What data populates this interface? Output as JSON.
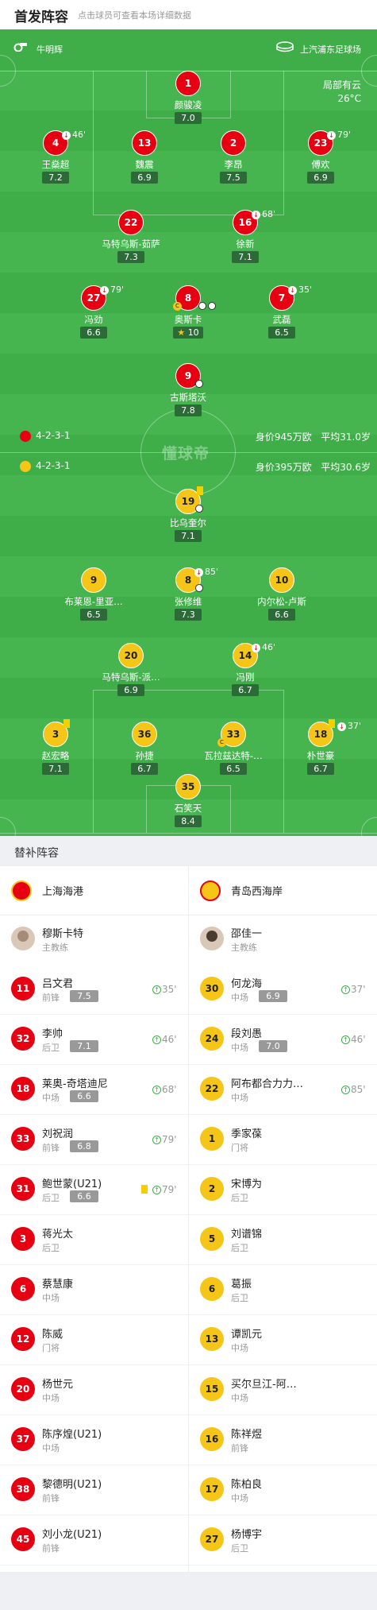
{
  "header": {
    "title": "首发阵容",
    "subtitle": "点击球员可查看本场详细数据"
  },
  "pitch": {
    "home_coach": "牛明辉",
    "venue": "上汽浦东足球场",
    "weather": "局部有云",
    "temperature": "26°C",
    "brand": "懂球帝",
    "top_team": {
      "formation": "4-2-3-1",
      "value": "身价945万欧",
      "avg_age": "平均31.0岁"
    },
    "bottom_team": {
      "formation": "4-2-3-1",
      "value": "身价395万欧",
      "avg_age": "平均30.6岁"
    },
    "top_players": [
      {
        "num": "1",
        "name": "颜骏凌",
        "rating": "7.0"
      },
      {
        "num": "4",
        "name": "王燊超",
        "rating": "7.2",
        "sub": "46'"
      },
      {
        "num": "13",
        "name": "魏震",
        "rating": "6.9"
      },
      {
        "num": "2",
        "name": "李昂",
        "rating": "7.5"
      },
      {
        "num": "23",
        "name": "傅欢",
        "rating": "6.9",
        "sub": "79'"
      },
      {
        "num": "22",
        "name": "马特乌斯-茹萨",
        "rating": "7.3"
      },
      {
        "num": "16",
        "name": "徐新",
        "rating": "7.1",
        "sub": "68'"
      },
      {
        "num": "27",
        "name": "冯劲",
        "rating": "6.6",
        "sub": "79'"
      },
      {
        "num": "8",
        "name": "奥斯卡",
        "rating": "10"
      },
      {
        "num": "7",
        "name": "武磊",
        "rating": "6.5",
        "sub": "35'"
      },
      {
        "num": "9",
        "name": "古斯塔沃",
        "rating": "7.8"
      }
    ],
    "bottom_players": [
      {
        "num": "19",
        "name": "比乌奎尔",
        "rating": "7.1"
      },
      {
        "num": "9",
        "name": "布莱恩-里亚…",
        "rating": "6.5"
      },
      {
        "num": "8",
        "name": "张修维",
        "rating": "7.3",
        "sub": "85'"
      },
      {
        "num": "10",
        "name": "内尔松-卢斯",
        "rating": "6.6"
      },
      {
        "num": "20",
        "name": "马特乌斯-派…",
        "rating": "6.9"
      },
      {
        "num": "14",
        "name": "冯刚",
        "rating": "6.7",
        "sub": "46'"
      },
      {
        "num": "3",
        "name": "赵宏略",
        "rating": "7.1"
      },
      {
        "num": "36",
        "name": "孙捷",
        "rating": "6.7"
      },
      {
        "num": "33",
        "name": "瓦拉兹达特-…",
        "rating": "6.5"
      },
      {
        "num": "18",
        "name": "朴世豪",
        "rating": "6.7",
        "sub": "37'"
      },
      {
        "num": "35",
        "name": "石笑天",
        "rating": "8.4"
      }
    ]
  },
  "subs": {
    "title": "替补阵容",
    "home_team": "上海海港",
    "away_team": "青岛西海岸",
    "home_coach": {
      "name": "穆斯卡特",
      "role": "主教练"
    },
    "away_coach": {
      "name": "邵佳一",
      "role": "主教练"
    },
    "home": [
      {
        "num": "11",
        "name": "吕文君",
        "pos": "前锋",
        "rating": "7.5",
        "time": "35'"
      },
      {
        "num": "32",
        "name": "李帅",
        "pos": "后卫",
        "rating": "7.1",
        "time": "46'"
      },
      {
        "num": "18",
        "name": "莱奥-奇塔迪尼",
        "pos": "中场",
        "rating": "6.6",
        "time": "68'"
      },
      {
        "num": "33",
        "name": "刘祝润",
        "pos": "前锋",
        "rating": "6.8",
        "time": "79'"
      },
      {
        "num": "31",
        "name": "鲍世蒙(U21)",
        "pos": "后卫",
        "rating": "6.6",
        "time": "79'"
      },
      {
        "num": "3",
        "name": "蒋光太",
        "pos": "后卫"
      },
      {
        "num": "6",
        "name": "蔡慧康",
        "pos": "中场"
      },
      {
        "num": "12",
        "name": "陈威",
        "pos": "门将"
      },
      {
        "num": "20",
        "name": "杨世元",
        "pos": "中场"
      },
      {
        "num": "37",
        "name": "陈序煌(U21)",
        "pos": "中场"
      },
      {
        "num": "38",
        "name": "黎德明(U21)",
        "pos": "前锋"
      },
      {
        "num": "45",
        "name": "刘小龙(U21)",
        "pos": "前锋"
      }
    ],
    "away": [
      {
        "num": "30",
        "name": "何龙海",
        "pos": "中场",
        "rating": "6.9",
        "time": "37'"
      },
      {
        "num": "24",
        "name": "段刘愚",
        "pos": "中场",
        "rating": "7.0",
        "time": "46'"
      },
      {
        "num": "22",
        "name": "阿布都合力力…",
        "pos": "中场",
        "time": "85'"
      },
      {
        "num": "1",
        "name": "季家葆",
        "pos": "门将"
      },
      {
        "num": "2",
        "name": "宋博为",
        "pos": "后卫"
      },
      {
        "num": "5",
        "name": "刘谱锦",
        "pos": "后卫"
      },
      {
        "num": "6",
        "name": "葛振",
        "pos": "后卫"
      },
      {
        "num": "13",
        "name": "谭凯元",
        "pos": "中场"
      },
      {
        "num": "15",
        "name": "买尔旦江-阿…",
        "pos": "中场"
      },
      {
        "num": "16",
        "name": "陈祥煜",
        "pos": "前锋"
      },
      {
        "num": "17",
        "name": "陈柏良",
        "pos": "中场"
      },
      {
        "num": "27",
        "name": "杨博宇",
        "pos": "后卫"
      }
    ]
  }
}
